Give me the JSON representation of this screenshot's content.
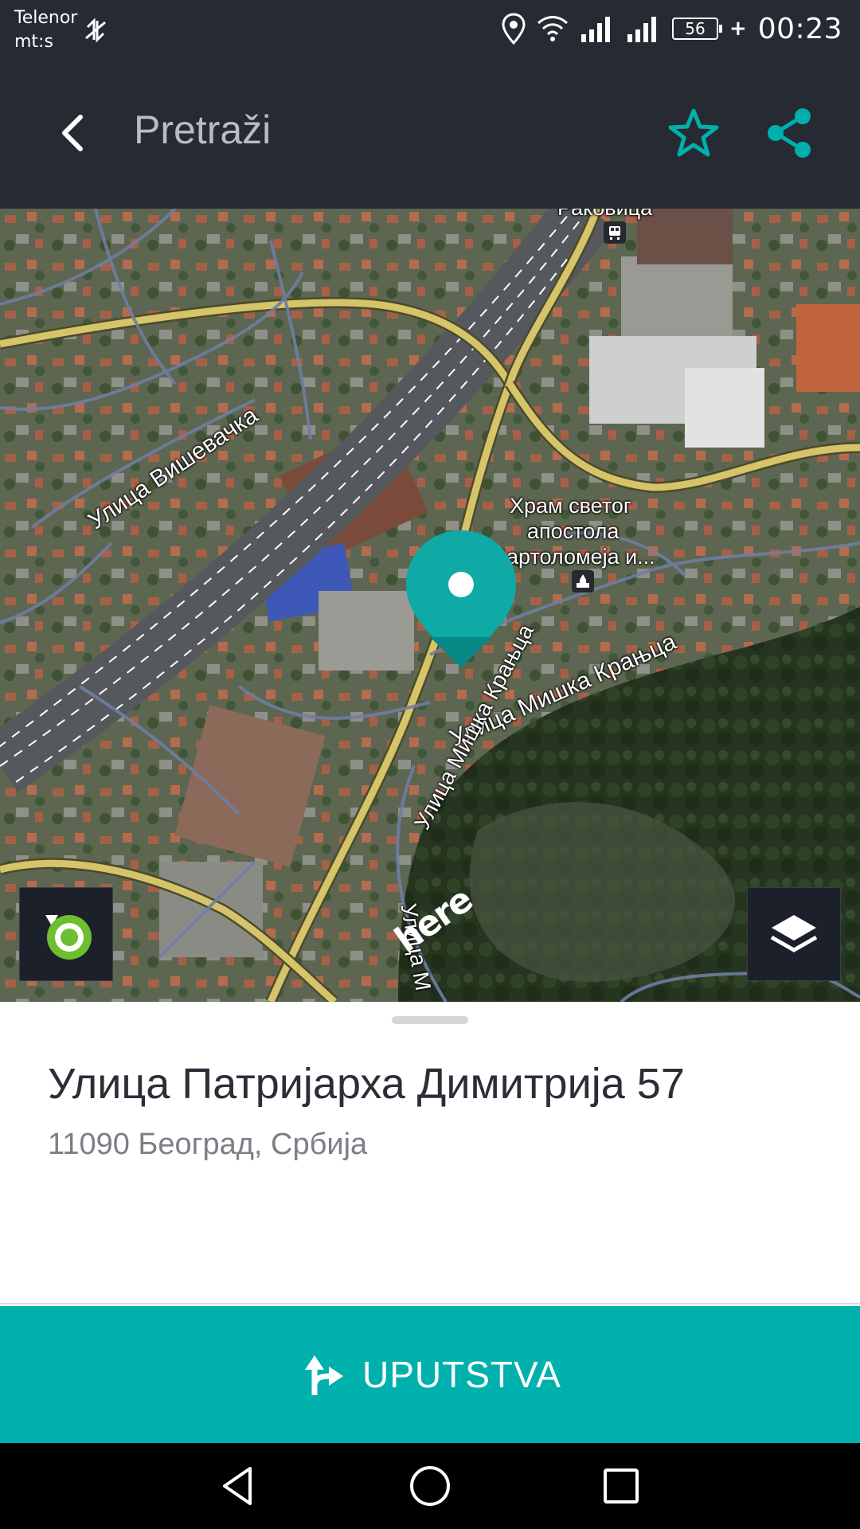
{
  "status_bar": {
    "carrier_line1": "Telenor",
    "carrier_line2": "mt:s",
    "battery": "56",
    "charging": "+",
    "time": "00:23"
  },
  "app_bar": {
    "title": "Pretraži",
    "accent_color": "#00b0ad"
  },
  "map": {
    "labels": {
      "rakovica": "Раковица",
      "visevacka": "Улица Вишевачка",
      "church_line1": "Храм светог",
      "church_line2": "апостола",
      "church_line3": "Вартоломеја и...",
      "miska_kranjca": "Улица Мишка Крањца",
      "mis_road": "Улица Мишка Крањца",
      "bottom_street": "Улица М"
    },
    "logo": "here",
    "icons": [
      "locate-icon",
      "layers-icon",
      "location-pin-icon",
      "train-station-icon",
      "church-icon"
    ]
  },
  "place": {
    "title": "Улица Патријарха Димитрија 57",
    "subtitle": "11090 Београд, Србија"
  },
  "directions": {
    "label": "UPUTSTVA"
  },
  "nav": {
    "icons": [
      "back-triangle-icon",
      "home-circle-icon",
      "recents-square-icon"
    ]
  }
}
